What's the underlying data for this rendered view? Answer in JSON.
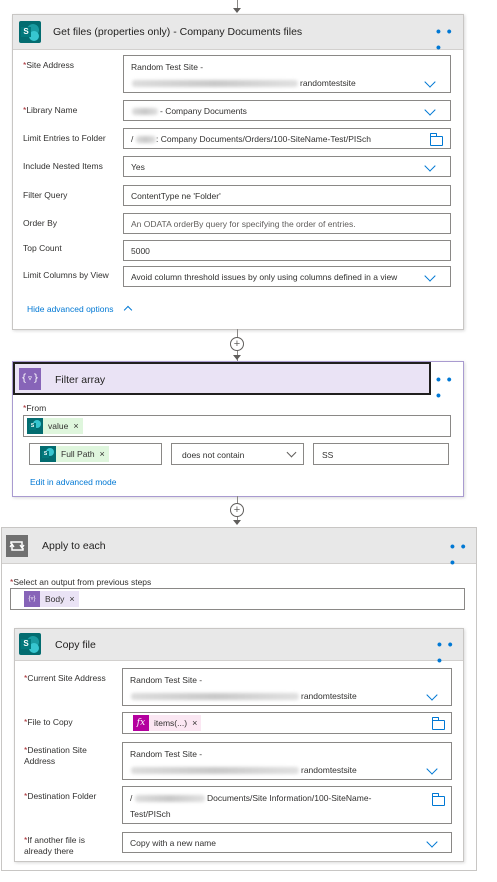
{
  "get_files": {
    "title": "Get files (properties only) - Company Documents files",
    "fields": {
      "site_address": {
        "label": "Site Address",
        "line1": "Random Test Site -",
        "line2_suffix": "randomtestsite"
      },
      "library_name": {
        "label": "Library Name",
        "value": "- Company Documents"
      },
      "limit_folder": {
        "label": "Limit Entries to Folder",
        "value_prefix": "/",
        "value": ": Company Documents/Orders/100-SiteName-Test/PISch"
      },
      "nested": {
        "label": "Include Nested Items",
        "value": "Yes"
      },
      "filter_query": {
        "label": "Filter Query",
        "value": "ContentType ne 'Folder'"
      },
      "order_by": {
        "label": "Order By",
        "placeholder": "An ODATA orderBy query for specifying the order of entries."
      },
      "top_count": {
        "label": "Top Count",
        "value": "5000"
      },
      "limit_columns": {
        "label": "Limit Columns by View",
        "value": "Avoid column threshold issues by only using columns defined in a view"
      }
    },
    "advanced_toggle": "Hide advanced options"
  },
  "filter_array": {
    "title": "Filter array",
    "from_label": "From",
    "from_token": "value",
    "condition_left_token": "Full Path",
    "condition_operator": "does not contain",
    "condition_value": "SS",
    "edit_advanced": "Edit in advanced mode"
  },
  "apply_each": {
    "title": "Apply to each",
    "select_label": "Select an output from previous steps",
    "select_token": "Body"
  },
  "copy_file": {
    "title": "Copy file",
    "fields": {
      "current_site": {
        "label": "Current Site Address",
        "line1": "Random Test Site -",
        "line2_suffix": "randomtestsite"
      },
      "file_to_copy": {
        "label": "File to Copy",
        "token": "items(...)"
      },
      "dest_site": {
        "label_line1": "Destination Site",
        "label_line2": "Address",
        "line1": "Random Test Site -",
        "line2_suffix": "randomtestsite"
      },
      "dest_folder": {
        "label": "Destination Folder",
        "line1_prefix": "/",
        "line1": "Documents/Site Information/100-SiteName-",
        "line2": "Test/PISch"
      },
      "if_exists": {
        "label_line1": "If another file is",
        "label_line2": "already there",
        "value": "Copy with a new name"
      }
    }
  },
  "common": {
    "required_mark": "*",
    "token_remove": "×",
    "more": "• • •",
    "add_step": "+",
    "sp_letter": "S",
    "filter_glyph": "{▿}",
    "expr_glyph": "fx"
  },
  "colors": {
    "accent": "#0078d4",
    "sharepoint": "#036c70",
    "filter": "#8764b8",
    "expression": "#b4009e",
    "required": "#a4262c"
  }
}
